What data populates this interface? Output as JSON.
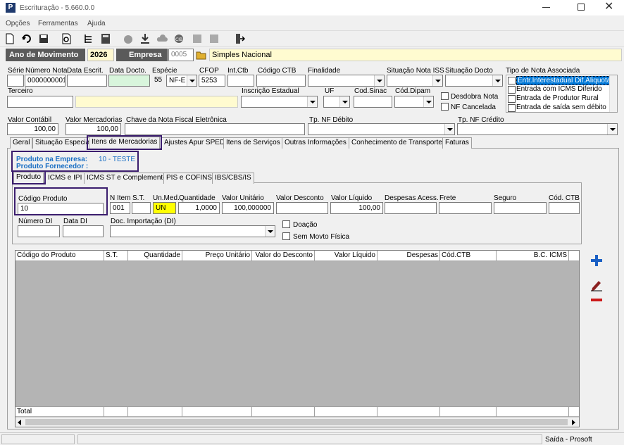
{
  "window": {
    "title": "Escrituração - 5.660.0.0"
  },
  "menu": [
    "Opções",
    "Ferramentas",
    "Ajuda"
  ],
  "header": {
    "ano_label": "Ano de Movimento",
    "ano_value": "2026",
    "empresa_label": "Empresa",
    "empresa_code": "0005",
    "empresa_name": "Simples Nacional"
  },
  "row1": {
    "serie_label": "Série",
    "numero_label": "Número Nota",
    "numero_value": "0000000001",
    "data_escrit_label": "Data Escrit.",
    "data_docto_label": "Data Docto.",
    "especie_label": "Espécie",
    "especie_code": "55",
    "especie_value": "NF-E",
    "cfop_label": "CFOP",
    "cfop_value": "5253",
    "intctb_label": "Int.Ctb",
    "codctb_label": "Código CTB",
    "finalidade_label": "Finalidade",
    "sit_iss_label": "Situação Nota ISS",
    "sit_docto_label": "Situação Docto",
    "tipo_nota_label": "Tipo de Nota Associada"
  },
  "tipo_nota_options": [
    "Entr.Interestadual Dif.Aliquota",
    "Entrada com ICMS Diferido",
    "Entrada de Produtor Rural",
    "Entrada de saída sem débito"
  ],
  "row2": {
    "terceiro_label": "Terceiro",
    "insc_label": "Inscrição Estadual",
    "uf_label": "UF",
    "codsinac_label": "Cod.Sinac",
    "coddipam_label": "Cód.Dipam",
    "desdobra_label": "Desdobra Nota",
    "nfcancelada_label": "NF Cancelada"
  },
  "row3": {
    "valor_contabil_label": "Valor Contábil",
    "valor_contabil_value": "100,00",
    "valor_merc_label": "Valor Mercadorias",
    "valor_merc_value": "100,00",
    "chave_label": "Chave da Nota Fiscal Eletrônica",
    "tp_debito_label": "Tp. NF Débito",
    "tp_credito_label": "Tp. NF Crédito"
  },
  "main_tabs": [
    "Geral",
    "Situação Especial",
    "Itens de Mercadorias",
    "Ajustes Apur SPED",
    "Itens de Serviços",
    "Outras Informações",
    "Conhecimento de Transporte",
    "Faturas"
  ],
  "produto_info": {
    "empresa_label": "Produto na Empresa:",
    "empresa_value": "10 - TESTE",
    "fornecedor_label": "Produto Fornecedor :"
  },
  "sub_tabs": [
    "Produto",
    "ICMS e IPI",
    "ICMS ST e Complemento",
    "PIS e COFINS",
    "IBS/CBS/IS"
  ],
  "item": {
    "cod_produto_label": "Código Produto",
    "cod_produto_value": "10",
    "nitem_label": "N Item",
    "nitem_value": "001",
    "st_label": "S.T.",
    "unmed_label": "Un.Med.",
    "unmed_value": "UN",
    "quantidade_label": "Quantidade",
    "quantidade_value": "1,0000",
    "valor_unit_label": "Valor Unitário",
    "valor_unit_value": "100,000000",
    "valor_desc_label": "Valor Desconto",
    "valor_liq_label": "Valor Líquido",
    "valor_liq_value": "100,00",
    "desp_label": "Despesas Acess.",
    "frete_label": "Frete",
    "seguro_label": "Seguro",
    "codctb_label": "Cód. CTB",
    "numero_di_label": "Número DI",
    "data_di_label": "Data DI",
    "doc_imp_label": "Doc. Importação (DI)",
    "doacao_label": "Doação",
    "sem_movto_label": "Sem Movto Física"
  },
  "grid": {
    "columns": [
      "Código do Produto",
      "S.T.",
      "Quantidade",
      "Preço Unitário",
      "Valor do Desconto",
      "Valor Líquido",
      "Despesas",
      "Cód.CTB",
      "B.C. ICMS"
    ],
    "total_label": "Total"
  },
  "status": {
    "right": "Saída - Prosoft"
  },
  "colors": {
    "accent_blue": "#1a6fc4",
    "highlight_yellow": "#ffff00",
    "header_dark": "#5a5a5a",
    "select_blue": "#0078d7"
  }
}
